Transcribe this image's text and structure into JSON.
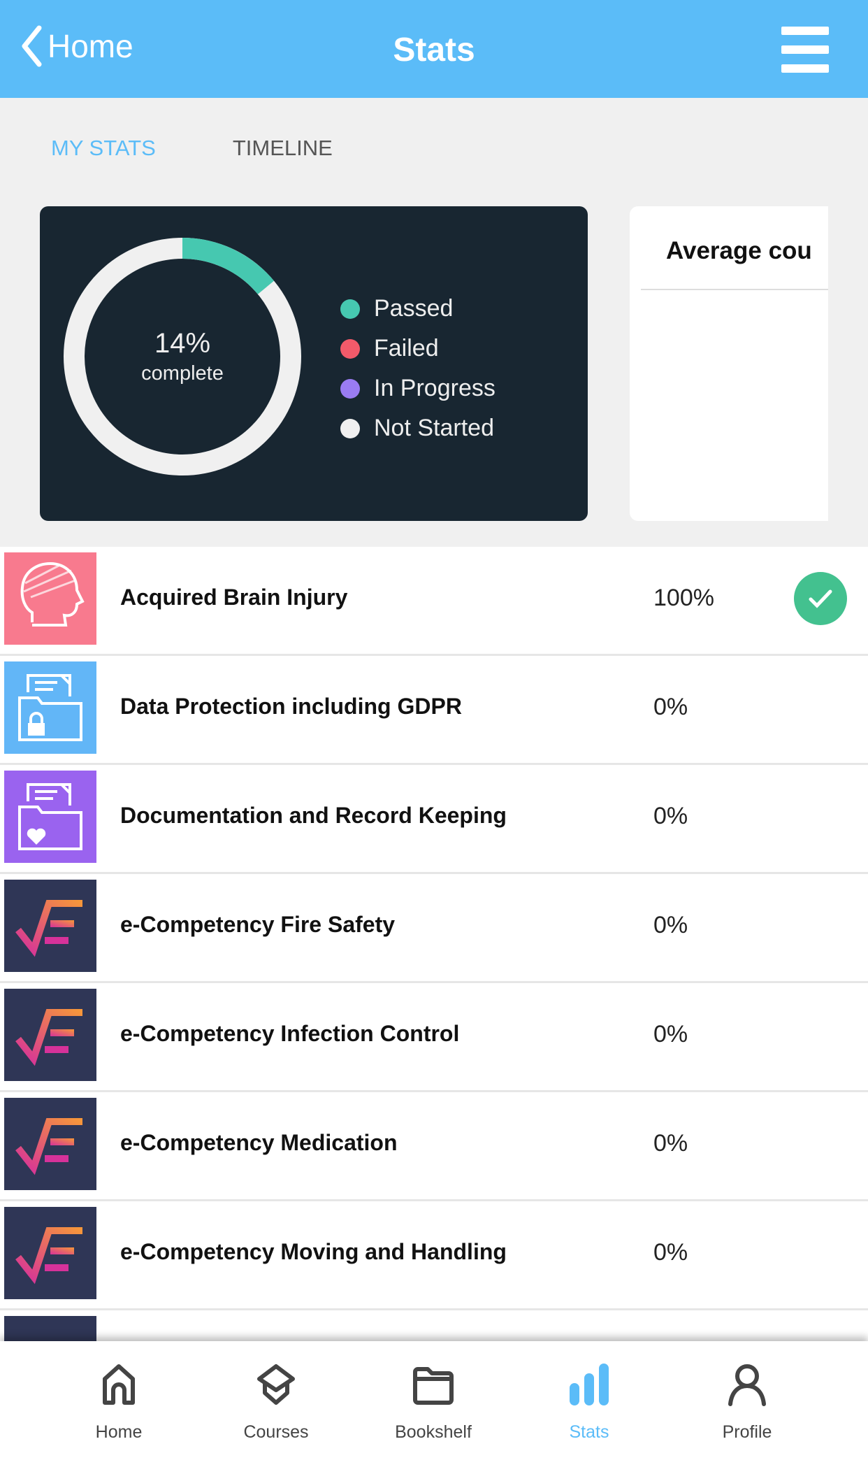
{
  "header": {
    "back_label": "Home",
    "title": "Stats"
  },
  "tabs": [
    {
      "label": "MY STATS",
      "active": true
    },
    {
      "label": "TIMELINE",
      "active": false
    }
  ],
  "progress_card": {
    "percent_text": "14%",
    "complete_label": "complete",
    "passed_fraction": 0.14,
    "legend": [
      {
        "label": "Passed",
        "color": "#46c8b0"
      },
      {
        "label": "Failed",
        "color": "#f25a6a"
      },
      {
        "label": "In Progress",
        "color": "#9a7cf2"
      },
      {
        "label": "Not Started",
        "color": "#f0f0f0"
      }
    ]
  },
  "average_card": {
    "title": "Average cou"
  },
  "courses": [
    {
      "name": "Acquired Brain Injury",
      "percent": "100%",
      "icon": "head-bandage-icon",
      "color": "#f87a8e",
      "completed": true
    },
    {
      "name": "Data Protection including GDPR",
      "percent": "0%",
      "icon": "folder-lock-icon",
      "color": "#62b6f7",
      "completed": false
    },
    {
      "name": "Documentation and Record Keeping",
      "percent": "0%",
      "icon": "folder-heart-icon",
      "color": "#9a63ef",
      "completed": false
    },
    {
      "name": "e-Competency Fire Safety",
      "percent": "0%",
      "icon": "e-competency-logo-icon",
      "color": "#2f3656",
      "completed": false
    },
    {
      "name": "e-Competency Infection Control",
      "percent": "0%",
      "icon": "e-competency-logo-icon",
      "color": "#2f3656",
      "completed": false
    },
    {
      "name": "e-Competency Medication",
      "percent": "0%",
      "icon": "e-competency-logo-icon",
      "color": "#2f3656",
      "completed": false
    },
    {
      "name": "e-Competency Moving and Handling",
      "percent": "0%",
      "icon": "e-competency-logo-icon",
      "color": "#2f3656",
      "completed": false
    }
  ],
  "nav": [
    {
      "label": "Home",
      "icon": "home-icon"
    },
    {
      "label": "Courses",
      "icon": "graduation-cap-icon"
    },
    {
      "label": "Bookshelf",
      "icon": "folder-icon"
    },
    {
      "label": "Stats",
      "icon": "bar-chart-icon",
      "active": true
    },
    {
      "label": "Profile",
      "icon": "user-icon"
    }
  ],
  "colors": {
    "accent": "#5bbcf8",
    "dark_card": "#182631",
    "check": "#43c18f"
  }
}
